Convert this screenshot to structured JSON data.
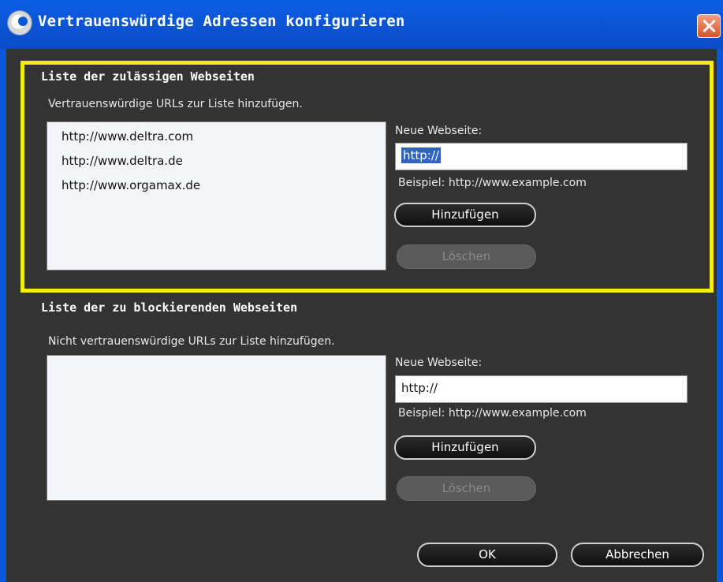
{
  "window": {
    "title": "Vertrauenswürdige Adressen konfigurieren"
  },
  "allowed": {
    "section_title": "Liste der zulässigen Webseiten",
    "hint": "Vertrauenswürdige URLs zur Liste hinzufügen.",
    "items": [
      "http://www.deltra.com",
      "http://www.deltra.de",
      "http://www.orgamax.de"
    ],
    "new_label": "Neue Webseite:",
    "input_value": "http://",
    "example": "Beispiel: http://www.example.com",
    "add_label": "Hinzufügen",
    "delete_label": "Löschen"
  },
  "blocked": {
    "section_title": "Liste der zu blockierenden Webseiten",
    "hint": "Nicht vertrauenswürdige URLs zur Liste hinzufügen.",
    "items": [],
    "new_label": "Neue Webseite:",
    "input_value": "http://",
    "example": "Beispiel: http://www.example.com",
    "add_label": "Hinzufügen",
    "delete_label": "Löschen"
  },
  "footer": {
    "ok_label": "OK",
    "cancel_label": "Abbrechen"
  },
  "colors": {
    "titlebar": "#0b56d8",
    "dialog_background": "#333333",
    "highlight_border": "#f5ec16",
    "selection": "#2f63c8"
  }
}
